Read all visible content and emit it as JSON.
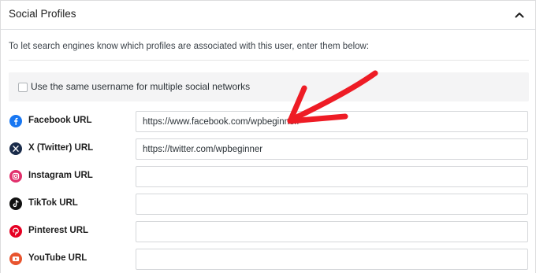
{
  "panel": {
    "title": "Social Profiles",
    "description": "To let search engines know which profiles are associated with this user, enter them below:"
  },
  "same_username": {
    "label": "Use the same username for multiple social networks",
    "checked": false
  },
  "fields": [
    {
      "label": "Facebook URL",
      "value": "https://www.facebook.com/wpbeginner/",
      "icon": "facebook-icon",
      "icon_color": "#1877f2"
    },
    {
      "label": "X (Twitter) URL",
      "value": "https://twitter.com/wpbeginner",
      "icon": "x-twitter-icon",
      "icon_color": "#1a2b4a"
    },
    {
      "label": "Instagram URL",
      "value": "",
      "icon": "instagram-icon",
      "icon_color": "#e1306c"
    },
    {
      "label": "TikTok URL",
      "value": "",
      "icon": "tiktok-icon",
      "icon_color": "#111111"
    },
    {
      "label": "Pinterest URL",
      "value": "",
      "icon": "pinterest-icon",
      "icon_color": "#e60023"
    },
    {
      "label": "YouTube URL",
      "value": "",
      "icon": "youtube-icon",
      "icon_color": "#e8542e"
    }
  ],
  "annotation": {
    "arrow_color": "#ee1c25"
  }
}
